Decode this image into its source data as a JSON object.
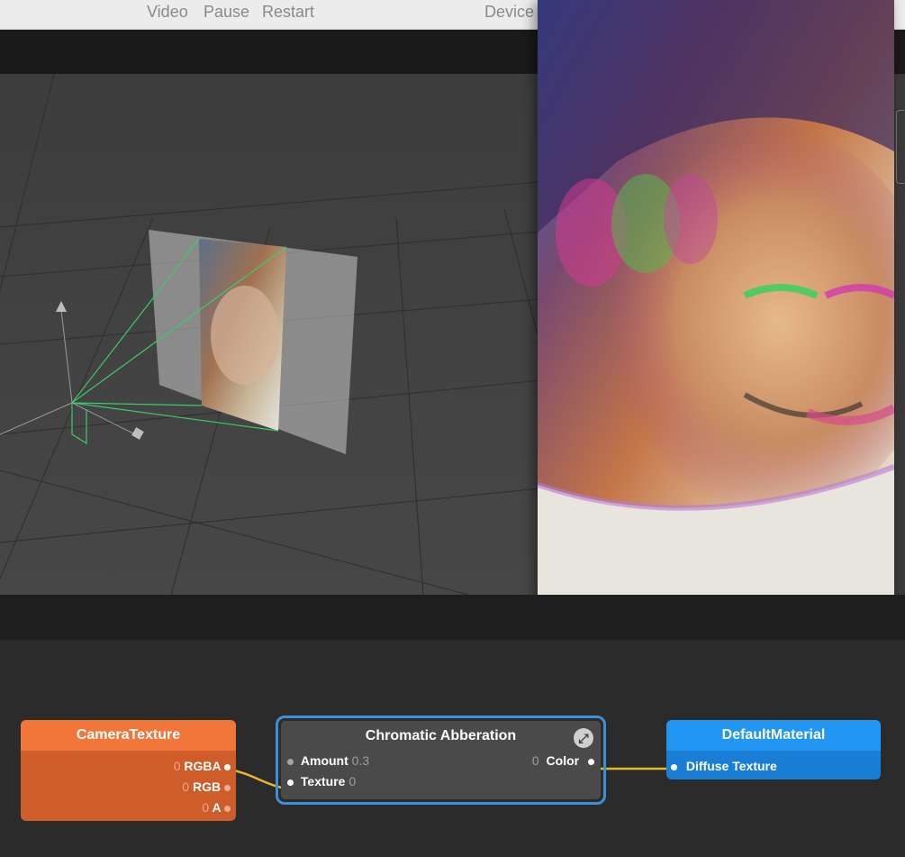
{
  "toolbar": {
    "video": "Video",
    "pause": "Pause",
    "restart": "Restart",
    "device": "Device"
  },
  "nodes": {
    "camera_texture": {
      "title": "CameraTexture",
      "color": "#f0763a",
      "outputs": [
        {
          "value": "0",
          "label": "RGBA"
        },
        {
          "value": "0",
          "label": "RGB"
        },
        {
          "value": "0",
          "label": "A"
        }
      ]
    },
    "chromatic": {
      "title": "Chromatic Abberation",
      "selected_color": "#3f8fd8",
      "inputs": [
        {
          "label": "Amount",
          "value": "0.3"
        },
        {
          "label": "Texture",
          "value": "0"
        }
      ],
      "output": {
        "value": "0",
        "label": "Color"
      },
      "expand_icon": "expand-icon"
    },
    "default_material": {
      "title": "DefaultMaterial",
      "color": "#2196f3",
      "inputs": [
        {
          "label": "Diffuse Texture"
        }
      ]
    }
  },
  "connection_color": "#e8b62c"
}
